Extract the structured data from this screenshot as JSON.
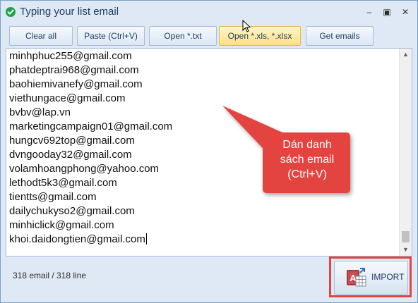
{
  "window": {
    "title": "Typing your list email",
    "controls": {
      "minimize": "–",
      "maximize": "▣",
      "close": "✕"
    }
  },
  "toolbar": {
    "clear_all": "Clear all",
    "paste": "Paste (Ctrl+V)",
    "open_txt": "Open *.txt",
    "open_xls": "Open *.xls, *.xlsx",
    "get_emails": "Get emails"
  },
  "editor": {
    "lines": [
      "minhphuc255@gmail.com",
      "phatdeptrai968@gmail.com",
      "baohiemivanefy@gmail.com",
      "viethungace@gmail.com",
      "bvbv@lap.vn",
      "marketingcampaign01@gmail.com",
      "hungcv692top@gmail.com",
      "dvngooday32@gmail.com",
      "volamhoangphong@yahoo.com",
      "lethodt5k3@gmail.com",
      "tientts@gmail.com",
      "dailychukyso2@gmail.com",
      "minhiclick@gmail.com",
      "khoi.daidongtien@gmail.com"
    ]
  },
  "callout": {
    "line1": "Dán danh",
    "line2": "sách email",
    "line3": "(Ctrl+V)",
    "color": "#e3443f"
  },
  "status": {
    "count_text": "318 email / 318 line"
  },
  "import": {
    "label": "IMPORT",
    "highlight_color": "#e3443f"
  },
  "icons": {
    "app": "green-check-circle-icon",
    "import": "access-database-icon",
    "cursor": "mouse-pointer-icon"
  }
}
